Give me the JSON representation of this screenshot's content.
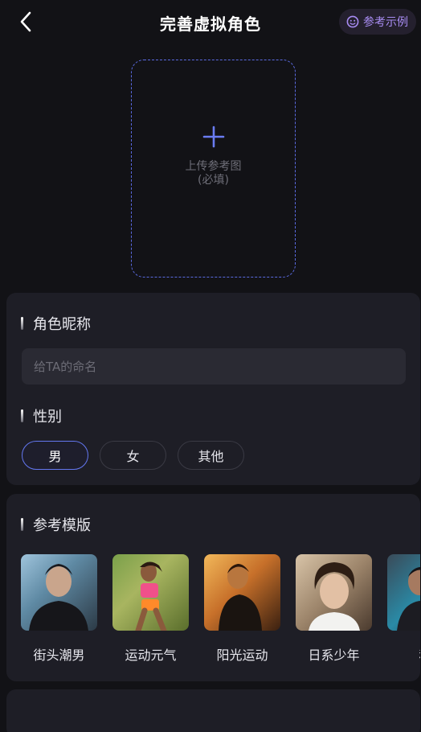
{
  "header": {
    "title": "完善虚拟角色",
    "example_label": "参考示例"
  },
  "upload": {
    "line1": "上传参考图",
    "line2": "(必填)"
  },
  "nickname": {
    "title": "角色昵称",
    "placeholder": "给TA的命名",
    "value": ""
  },
  "gender": {
    "title": "性别",
    "options": [
      "男",
      "女",
      "其他"
    ],
    "selected": "男"
  },
  "templates": {
    "title": "参考模版",
    "items": [
      {
        "label": "街头潮男"
      },
      {
        "label": "运动元气"
      },
      {
        "label": "阳光运动"
      },
      {
        "label": "日系少年"
      },
      {
        "label": "科"
      }
    ]
  },
  "colors": {
    "accent": "#6377f0",
    "example_text": "#a88cf3",
    "card_bg": "#1e1e26",
    "page_bg": "#121216"
  }
}
